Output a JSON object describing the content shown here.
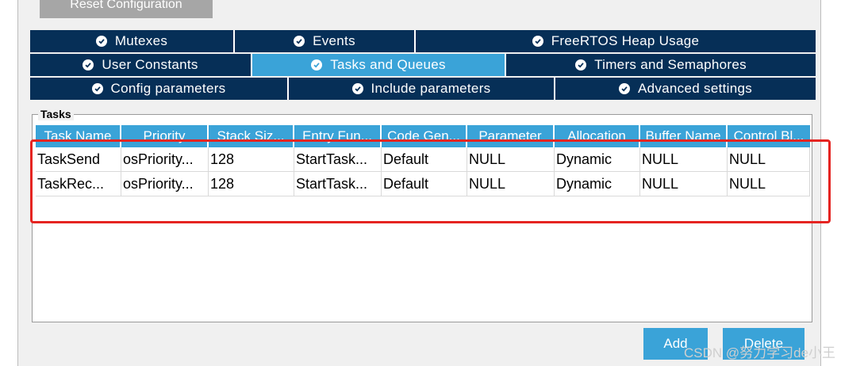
{
  "reset_button": "Reset Configuration",
  "tabs": {
    "row1": [
      {
        "label": "Mutexes",
        "active": false
      },
      {
        "label": "Events",
        "active": false
      },
      {
        "label": "FreeRTOS Heap Usage",
        "active": false
      }
    ],
    "row2": [
      {
        "label": "User Constants",
        "active": false
      },
      {
        "label": "Tasks and Queues",
        "active": true
      },
      {
        "label": "Timers and Semaphores",
        "active": false
      }
    ],
    "row3": [
      {
        "label": "Config parameters",
        "active": false
      },
      {
        "label": "Include parameters",
        "active": false
      },
      {
        "label": "Advanced settings",
        "active": false
      }
    ]
  },
  "tasks": {
    "group_title": "Tasks",
    "columns": [
      "Task Name",
      "Priority",
      "Stack Siz...",
      "Entry Fun...",
      "Code Gen...",
      "Parameter",
      "Allocation",
      "Buffer Name",
      "Control Bl..."
    ],
    "rows": [
      [
        "TaskSend",
        "osPriority...",
        "128",
        "StartTask...",
        "Default",
        "NULL",
        "Dynamic",
        "NULL",
        "NULL"
      ],
      [
        "TaskRec...",
        "osPriority...",
        "128",
        "StartTask...",
        "Default",
        "NULL",
        "Dynamic",
        "NULL",
        "NULL"
      ]
    ]
  },
  "buttons": {
    "add": "Add",
    "delete": "Delete"
  },
  "watermark": "CSDN @努力学习de小王",
  "colors": {
    "tab_dark": "#062f57",
    "tab_active": "#3aa3d8",
    "highlight": "#e52421"
  }
}
